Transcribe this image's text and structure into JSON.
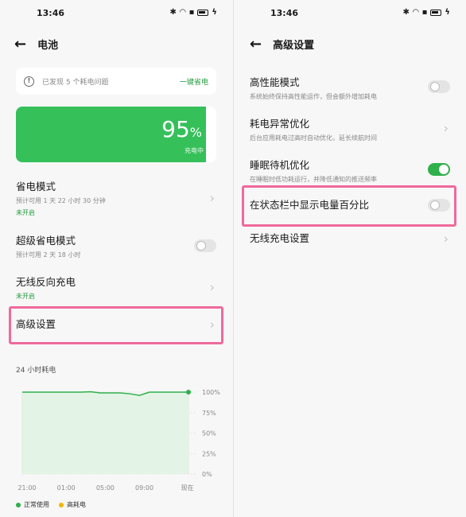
{
  "left": {
    "status": {
      "time": "13:46"
    },
    "title": "电池",
    "notice": {
      "text": "已发现 5 个耗电问题",
      "action": "一键省电"
    },
    "battery": {
      "percent": "95",
      "percent_sign": "%",
      "state": "充电中",
      "level": 0.95,
      "color": "#35c05a"
    },
    "rows": {
      "save_mode": {
        "title": "省电模式",
        "sub": "预计可用 1 天 22 小时 30 分钟",
        "status": "未开启"
      },
      "super_save": {
        "title": "超级省电模式",
        "sub": "预计可用 2 天 18 小时",
        "toggle_on": false
      },
      "reverse_charge": {
        "title": "无线反向充电",
        "status": "未开启"
      },
      "advanced": {
        "title": "高级设置"
      }
    },
    "chart_title": "24 小时耗电",
    "legend": {
      "normal": "正常使用",
      "high": "高耗电",
      "normal_color": "#2fb04a",
      "high_color": "#f5b300"
    }
  },
  "right": {
    "status": {
      "time": "13:46"
    },
    "title": "高级设置",
    "rows": {
      "performance": {
        "title": "高性能模式",
        "sub": "系统始终保持高性能运作，但会额外增加耗电",
        "toggle_on": false
      },
      "abnormal": {
        "title": "耗电异常优化",
        "sub": "后台应用耗电过高时自动优化，延长续航时间"
      },
      "sleep": {
        "title": "睡眠待机优化",
        "sub": "在睡眠时低功耗运行，并降低通知的推送频率",
        "toggle_on": true
      },
      "percent": {
        "title": "在状态栏中显示电量百分比",
        "toggle_on": false
      },
      "wireless": {
        "title": "无线充电设置"
      }
    }
  },
  "highlight_color": "#ef6a9b",
  "chart_data": {
    "type": "area",
    "title": "24 小时耗电",
    "x": [
      0,
      1,
      2,
      3,
      4,
      5,
      6,
      7,
      8,
      9,
      10,
      11,
      12,
      13,
      14,
      15,
      16,
      17
    ],
    "x_tick_labels": [
      "21:00",
      "01:00",
      "05:00",
      "09:00",
      "现在"
    ],
    "x_tick_positions": [
      0,
      4,
      8,
      12,
      16.4
    ],
    "y_tick_labels": [
      "100%",
      "75%",
      "50%",
      "25%",
      "0%"
    ],
    "ylim": [
      0,
      100
    ],
    "series": [
      {
        "name": "正常使用",
        "values": [
          100,
          100,
          100,
          100,
          100,
          100,
          100,
          100.5,
          99,
          99,
          99,
          98,
          96,
          100,
          100,
          100,
          100,
          100
        ]
      }
    ]
  }
}
